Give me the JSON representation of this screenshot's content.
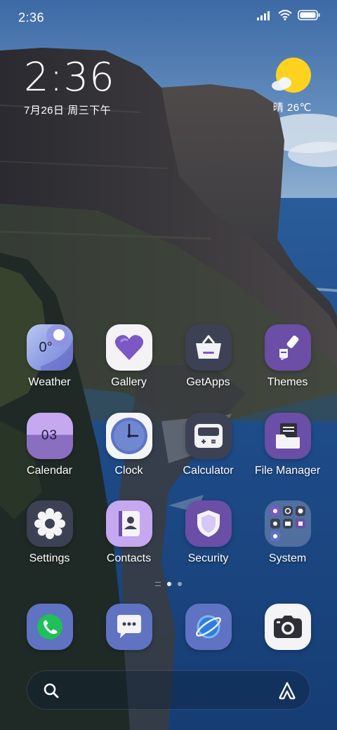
{
  "status_bar": {
    "time": "2:36",
    "icons": [
      "signal-icon",
      "wifi-icon",
      "battery-icon"
    ]
  },
  "clock_widget": {
    "time": "2:36",
    "date": "7月26日 周三下午"
  },
  "weather_widget": {
    "icon": "sunny-cloud-icon",
    "text": "晴 26℃"
  },
  "apps": [
    {
      "label": "Weather",
      "icon": "weather-icon",
      "badge": "0°"
    },
    {
      "label": "Gallery",
      "icon": "heart-icon"
    },
    {
      "label": "GetApps",
      "icon": "basket-icon"
    },
    {
      "label": "Themes",
      "icon": "paintbrush-icon"
    },
    {
      "label": "Calendar",
      "icon": "calendar-icon",
      "badge": "03"
    },
    {
      "label": "Clock",
      "icon": "clock-icon"
    },
    {
      "label": "Calculator",
      "icon": "calculator-icon"
    },
    {
      "label": "File Manager",
      "icon": "folder-icon"
    },
    {
      "label": "Settings",
      "icon": "gear-icon"
    },
    {
      "label": "Contacts",
      "icon": "contact-card-icon"
    },
    {
      "label": "Security",
      "icon": "shield-icon"
    },
    {
      "label": "System",
      "icon": "folder-grid-icon"
    }
  ],
  "page_indicator": {
    "pages": 2,
    "active": 1
  },
  "dock": [
    {
      "icon": "phone-icon"
    },
    {
      "icon": "message-icon"
    },
    {
      "icon": "browser-icon"
    },
    {
      "icon": "camera-icon"
    }
  ],
  "search_bar": {
    "search_icon": "search-icon",
    "assistant_icon": "assistant-icon"
  },
  "colors": {
    "accent_purple": "#6b4ea6",
    "icon_dark": "#3d4154",
    "icon_blue": "#5f73c2",
    "sky": "#5d86b8",
    "sea": "#1f4f8c",
    "sun": "#ffd21f"
  }
}
